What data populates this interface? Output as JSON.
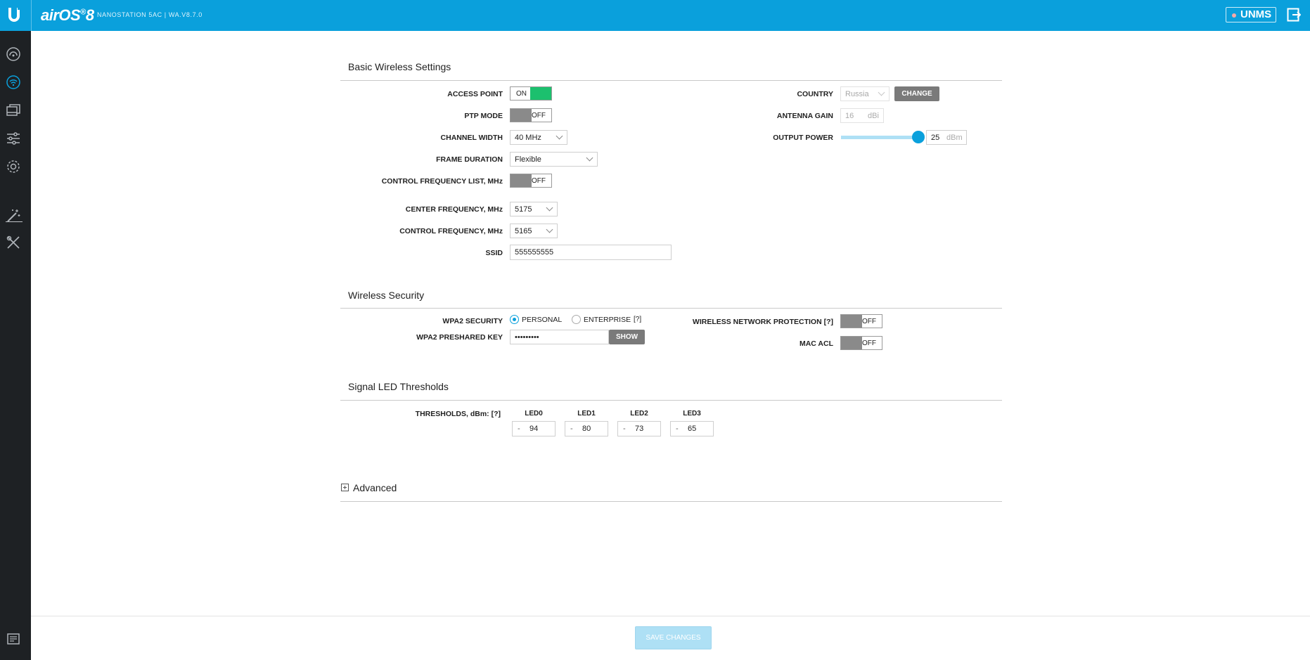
{
  "header": {
    "brand": "airOS",
    "brand_version": "8",
    "device": "NANOSTATION 5AC | WA.V8.7.0",
    "unms_label": "UNMS"
  },
  "icons": {
    "logo": "ubiquiti-u-logo",
    "logout": "logout-icon",
    "sidebar": [
      "dashboard-icon",
      "wireless-icon",
      "network-icon",
      "services-icon",
      "settings-icon",
      "tools-icon",
      "utilities-icon",
      "log-icon"
    ]
  },
  "colors": {
    "brand_blue": "#0aa0dc",
    "toggle_on": "#1cc06e",
    "toggle_off": "#8a8a8a",
    "sidebar": "#1e2124"
  },
  "basic": {
    "title": "Basic Wireless Settings",
    "access_point": {
      "label": "ACCESS POINT",
      "state": "ON"
    },
    "ptp_mode": {
      "label": "PTP MODE",
      "state": "OFF"
    },
    "channel_width": {
      "label": "CHANNEL WIDTH",
      "value": "40 MHz"
    },
    "frame_duration": {
      "label": "FRAME DURATION",
      "value": "Flexible"
    },
    "control_freq_list": {
      "label": "CONTROL FREQUENCY LIST, MHz",
      "state": "OFF"
    },
    "center_freq": {
      "label": "CENTER FREQUENCY, MHz",
      "value": "5175"
    },
    "control_freq": {
      "label": "CONTROL FREQUENCY, MHz",
      "value": "5165"
    },
    "ssid": {
      "label": "SSID",
      "value": "555555555"
    },
    "country": {
      "label": "COUNTRY",
      "value": "Russia",
      "button": "CHANGE"
    },
    "antenna_gain": {
      "label": "ANTENNA GAIN",
      "value": "16",
      "unit": "dBi"
    },
    "output_power": {
      "label": "OUTPUT POWER",
      "value": "25",
      "unit": "dBm",
      "slider_percent": 100
    }
  },
  "security": {
    "title": "Wireless Security",
    "wpa2": {
      "label": "WPA2 SECURITY",
      "personal": "PERSONAL",
      "enterprise": "ENTERPRISE",
      "help": "[?]",
      "selected": "PERSONAL"
    },
    "preshared": {
      "label": "WPA2 PRESHARED KEY",
      "value": "•••••••••",
      "button": "SHOW"
    },
    "wnp": {
      "label": "WIRELESS NETWORK PROTECTION [?]",
      "state": "OFF"
    },
    "mac_acl": {
      "label": "MAC ACL",
      "state": "OFF"
    }
  },
  "led": {
    "title": "Signal LED Thresholds",
    "label": "THRESHOLDS, dBm: [?]",
    "minus": "-",
    "items": [
      {
        "name": "LED0",
        "value": "94"
      },
      {
        "name": "LED1",
        "value": "80"
      },
      {
        "name": "LED2",
        "value": "73"
      },
      {
        "name": "LED3",
        "value": "65"
      }
    ]
  },
  "advanced": {
    "title": "Advanced"
  },
  "footer": {
    "save": "SAVE CHANGES"
  }
}
